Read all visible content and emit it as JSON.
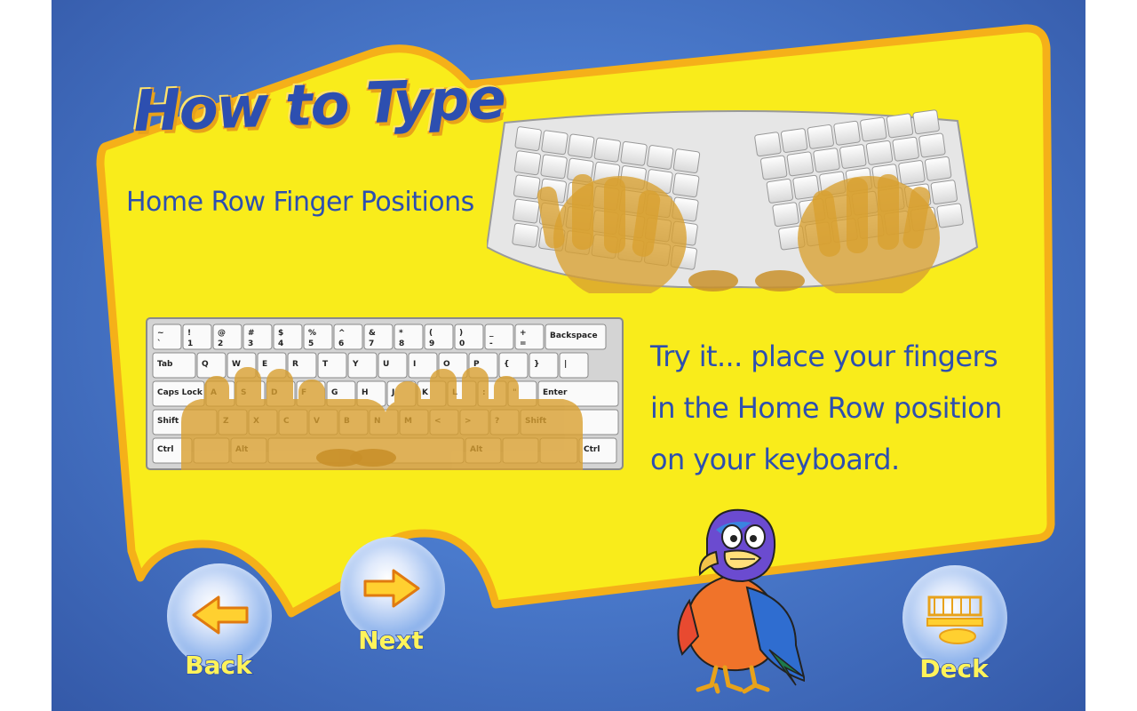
{
  "lesson": {
    "title": "How to Type",
    "subtitle": "Home Row Finger Positions",
    "instruction_lines": [
      "Try it... place your fingers",
      "in the Home Row position",
      "on your keyboard."
    ]
  },
  "nav": {
    "back_label": "Back",
    "next_label": "Next",
    "deck_label": "Deck"
  },
  "keyboard": {
    "row0": [
      "~",
      "!",
      "@",
      "#",
      "$",
      "%",
      "^",
      "&",
      "*",
      "(",
      ")",
      "_",
      "+"
    ],
    "row0_sub": [
      "`",
      "1",
      "2",
      "3",
      "4",
      "5",
      "6",
      "7",
      "8",
      "9",
      "0",
      "-",
      "="
    ],
    "backspace": "Backspace",
    "tab": "Tab",
    "row1": [
      "Q",
      "W",
      "E",
      "R",
      "T",
      "Y",
      "U",
      "I",
      "O",
      "P",
      "{",
      "}",
      "|"
    ],
    "caps": "Caps Lock",
    "row2": [
      "A",
      "S",
      "D",
      "F",
      "G",
      "H",
      "J",
      "K",
      "L",
      ":",
      "\""
    ],
    "enter": "Enter",
    "shift": "Shift",
    "row3": [
      "Z",
      "X",
      "C",
      "V",
      "B",
      "N",
      "M",
      "<",
      ">",
      "?"
    ],
    "ctrl": "Ctrl",
    "alt": "Alt"
  },
  "colors": {
    "panel_yellow": "#f9ec1b",
    "panel_border": "#f5b019",
    "text_blue": "#2d4fb0",
    "hand": "#d89a2e"
  }
}
